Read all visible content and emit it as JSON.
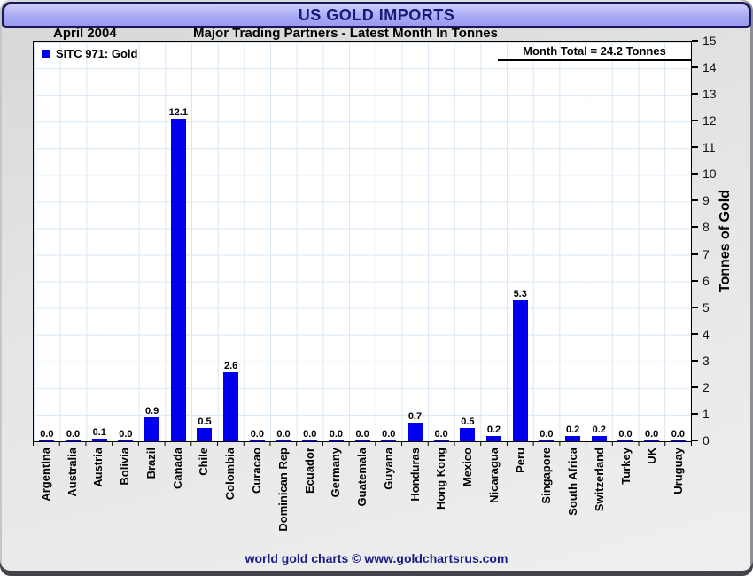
{
  "window": {
    "title": "US GOLD IMPORTS"
  },
  "header": {
    "date_label": "April 2004",
    "subtitle": "Major Trading Partners - Latest Month In Tonnes"
  },
  "legend": {
    "label": "SITC 971: Gold"
  },
  "annotation": {
    "month_total": "Month Total = 24.2 Tonnes"
  },
  "footer": {
    "credit": "world gold charts © www.goldchartsrus.com"
  },
  "colors": {
    "bar": "#0000EE",
    "grid": "#D9E7F4",
    "title_text": "#181878",
    "footer_text": "#1B1B84",
    "titlebar_gradient_top": "#CDCDFC",
    "titlebar_gradient_bottom": "#9A9AF0"
  },
  "chart_data": {
    "type": "bar",
    "title": "US GOLD IMPORTS",
    "subtitle": "Major Trading Partners - Latest Month In Tonnes",
    "period": "April 2004",
    "series_name": "SITC 971: Gold",
    "categories": [
      "Argentina",
      "Australia",
      "Austria",
      "Bolivia",
      "Brazil",
      "Canada",
      "Chile",
      "Colombia",
      "Curacao",
      "Dominican Rep",
      "Ecuador",
      "Germany",
      "Guatemala",
      "Guyana",
      "Honduras",
      "Hong Kong",
      "Mexico",
      "Nicaragua",
      "Peru",
      "Singapore",
      "South Africa",
      "Switzerland",
      "Turkey",
      "UK",
      "Uruguay"
    ],
    "values": [
      0.0,
      0.0,
      0.1,
      0.0,
      0.9,
      12.1,
      0.5,
      2.6,
      0.0,
      0.0,
      0.0,
      0.0,
      0.0,
      0.0,
      0.7,
      0.0,
      0.5,
      0.2,
      5.3,
      0.0,
      0.2,
      0.2,
      0.0,
      0.0,
      0.0
    ],
    "value_label_decimals": 1,
    "xlabel": "",
    "ylabel": "Tonnes of Gold",
    "ylim": [
      0,
      15
    ],
    "ytick_interval": 1,
    "grid": true,
    "legend_position": "top-left",
    "bar_color": "#0000EE",
    "month_total_tonnes": 24.2
  }
}
